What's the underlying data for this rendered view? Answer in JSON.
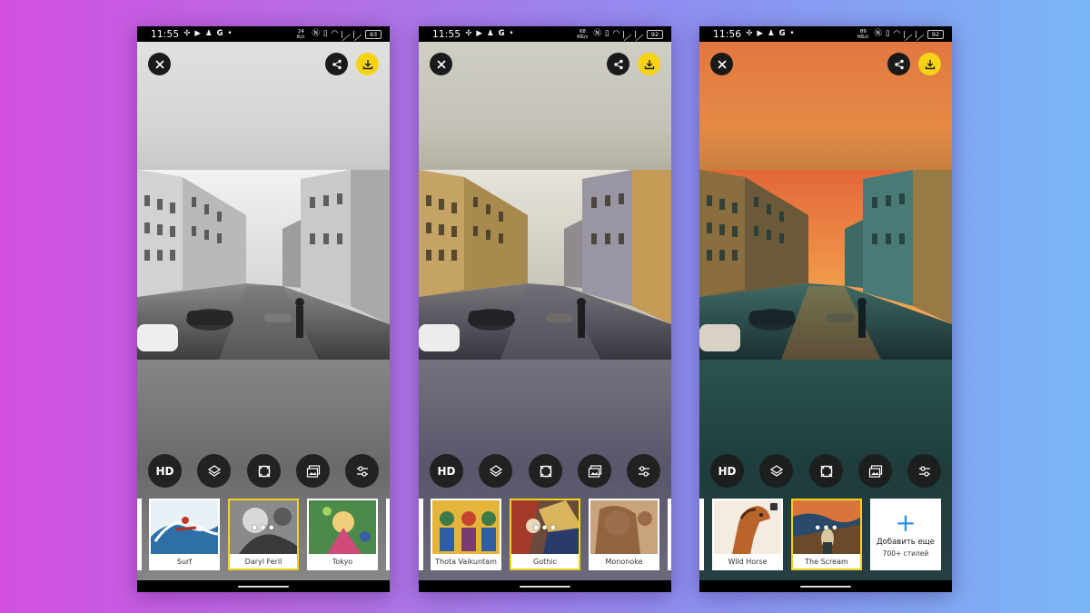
{
  "screens": [
    {
      "status": {
        "time": "11:55",
        "net_top": "24",
        "net_bottom": "Б/с",
        "battery": "93"
      },
      "styles": [
        {
          "label": "Surf"
        },
        {
          "label": "Daryl Feril",
          "selected": true
        },
        {
          "label": "Tokyo"
        }
      ]
    },
    {
      "status": {
        "time": "11:55",
        "net_top": "68",
        "net_bottom": "КБ/с",
        "battery": "92"
      },
      "styles": [
        {
          "label": "Thota Vaikuntam"
        },
        {
          "label": "Gothic",
          "selected": true
        },
        {
          "label": "Mononoke"
        }
      ]
    },
    {
      "status": {
        "time": "11:56",
        "net_top": "89",
        "net_bottom": "КБ/с",
        "battery": "92"
      },
      "styles": [
        {
          "label": "Wild Horse",
          "locked": true
        },
        {
          "label": "The Scream",
          "selected": true
        }
      ],
      "add_more": {
        "title": "Добавить еще",
        "subtitle": "700+ стилей"
      }
    }
  ],
  "tools": {
    "hd_label": "HD"
  },
  "selected_overlay": "•••",
  "icons": {
    "close": "close-icon",
    "share": "share-icon",
    "download": "download-icon",
    "layers": "layers-icon",
    "crop": "crop-icon",
    "gallery": "gallery-icon",
    "adjust": "sliders-icon",
    "add": "plus-icon",
    "lock": "lock-icon"
  },
  "colors": {
    "accent": "#f7d316",
    "selection": "#f3d21a",
    "add_plus": "#2f8cff"
  }
}
